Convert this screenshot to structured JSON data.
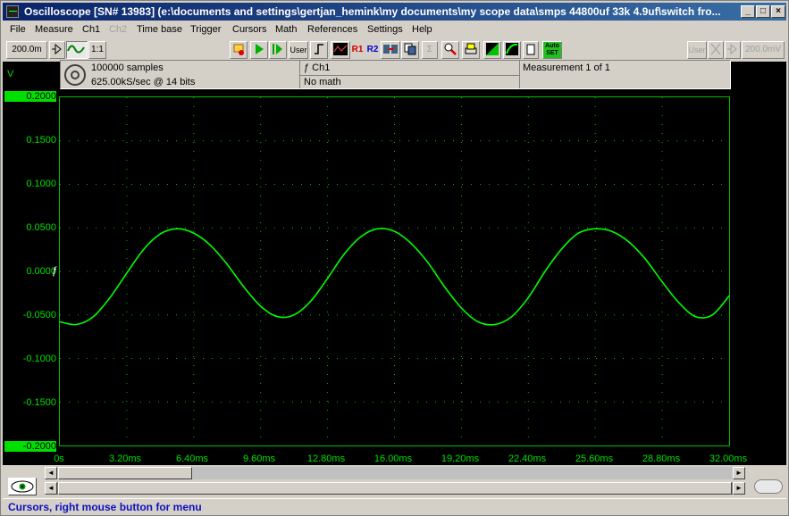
{
  "window": {
    "title": "Oscilloscope  [SN# 13983]  (e:\\documents and settings\\gertjan_hemink\\my documents\\my scope data\\smps 44800uf 33k 4.9uf\\switch fro..."
  },
  "menu": [
    "File",
    "Measure",
    "Ch1",
    "Ch2",
    "Time base",
    "Trigger",
    "Cursors",
    "Math",
    "References",
    "Settings",
    "Help"
  ],
  "toolbar": {
    "volt_div_ch1": "200.0m",
    "coupling_label": "1:1",
    "user_label": "User",
    "r1_label": "R1",
    "r2_label": "R2",
    "autoset_label": "Auto SET",
    "user_label_right": "User",
    "volt_div_right": "200.0mV"
  },
  "info": {
    "samples": "100000 samples",
    "rate": "625.00kS/sec @ 14 bits",
    "channel": "ƒ Ch1",
    "math": "No math",
    "measurement": "Measurement 1 of 1"
  },
  "axes": {
    "y_unit": "V",
    "y_ticks": [
      "0.2000",
      "0.1500",
      "0.1000",
      "0.0500",
      "0.0000",
      "-0.0500",
      "-0.1000",
      "-0.1500",
      "-0.2000"
    ],
    "x_ticks": [
      "0s",
      "3.20ms",
      "6.40ms",
      "9.60ms",
      "12.80ms",
      "16.00ms",
      "19.20ms",
      "22.40ms",
      "25.60ms",
      "28.80ms",
      "32.00ms"
    ],
    "trigger_marker": "ƒ"
  },
  "chart_data": {
    "type": "line",
    "xlabel": "",
    "ylabel": "V",
    "xlim": [
      0,
      32.0
    ],
    "ylim": [
      -0.2,
      0.2
    ],
    "grid": true,
    "series": [
      {
        "color": "#00ff00",
        "x": [
          0,
          0.8,
          1.6,
          2.4,
          3.2,
          4.0,
          4.8,
          5.6,
          6.4,
          7.2,
          8.0,
          8.8,
          9.6,
          10.4,
          11.2,
          12.0,
          12.8,
          13.6,
          14.4,
          15.2,
          16.0,
          16.8,
          17.6,
          18.4,
          19.2,
          20.0,
          20.8,
          21.6,
          22.4,
          23.2,
          24.0,
          24.8,
          25.6,
          26.4,
          27.2,
          28.0,
          28.8,
          29.6,
          30.4,
          31.2,
          32.0
        ],
        "y": [
          -0.058,
          -0.061,
          -0.052,
          -0.03,
          -0.002,
          0.025,
          0.043,
          0.049,
          0.044,
          0.03,
          0.008,
          -0.018,
          -0.04,
          -0.052,
          -0.05,
          -0.034,
          -0.008,
          0.02,
          0.04,
          0.049,
          0.046,
          0.032,
          0.01,
          -0.018,
          -0.042,
          -0.058,
          -0.061,
          -0.052,
          -0.03,
          0.0,
          0.026,
          0.044,
          0.049,
          0.046,
          0.034,
          0.014,
          -0.012,
          -0.036,
          -0.052,
          -0.05,
          -0.028
        ]
      }
    ]
  },
  "status": {
    "text": "Cursors, right mouse button for menu"
  },
  "colors": {
    "trace": "#00ff00",
    "grid": "#00c000",
    "label": "#00e000"
  }
}
